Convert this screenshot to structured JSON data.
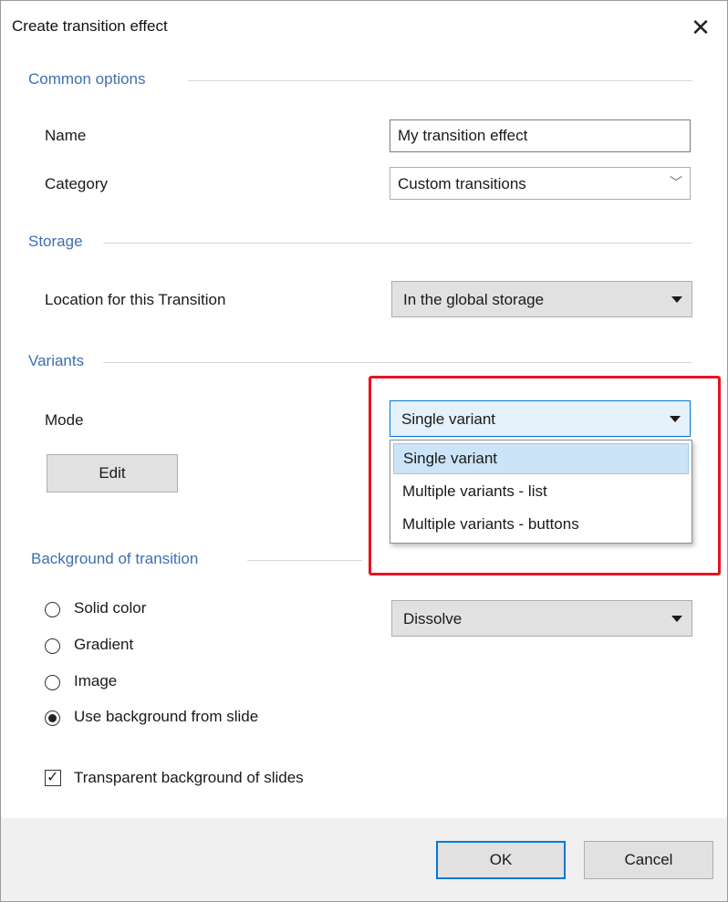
{
  "dialog": {
    "title": "Create transition effect",
    "close_glyph": "✕"
  },
  "common": {
    "heading": "Common options",
    "name_label": "Name",
    "name_value": "My transition effect",
    "category_label": "Category",
    "category_value": "Custom transitions",
    "category_chevron": "﹀"
  },
  "storage": {
    "heading": "Storage",
    "location_label": "Location for this Transition",
    "location_value": "In the global storage"
  },
  "variants": {
    "heading": "Variants",
    "mode_label": "Mode",
    "mode_value": "Single variant",
    "edit_label": "Edit",
    "options": [
      "Single variant",
      "Multiple variants - list",
      "Multiple variants - buttons"
    ],
    "selected_option": "Single variant",
    "highlight_color": "#e81123"
  },
  "background": {
    "heading": "Background of transition",
    "radios": [
      {
        "label": "Solid color",
        "checked": false
      },
      {
        "label": "Gradient",
        "checked": false
      },
      {
        "label": "Image",
        "checked": false
      },
      {
        "label": "Use background from slide",
        "checked": true
      }
    ],
    "effect_value": "Dissolve",
    "transparent_label": "Transparent background of slides",
    "transparent_checked": true,
    "check_glyph": "✓"
  },
  "footer": {
    "ok_label": "OK",
    "cancel_label": "Cancel"
  },
  "colors": {
    "accent": "#0078d7",
    "section_heading": "#3d6fb1",
    "selected_item_bg": "#cce4f7"
  }
}
